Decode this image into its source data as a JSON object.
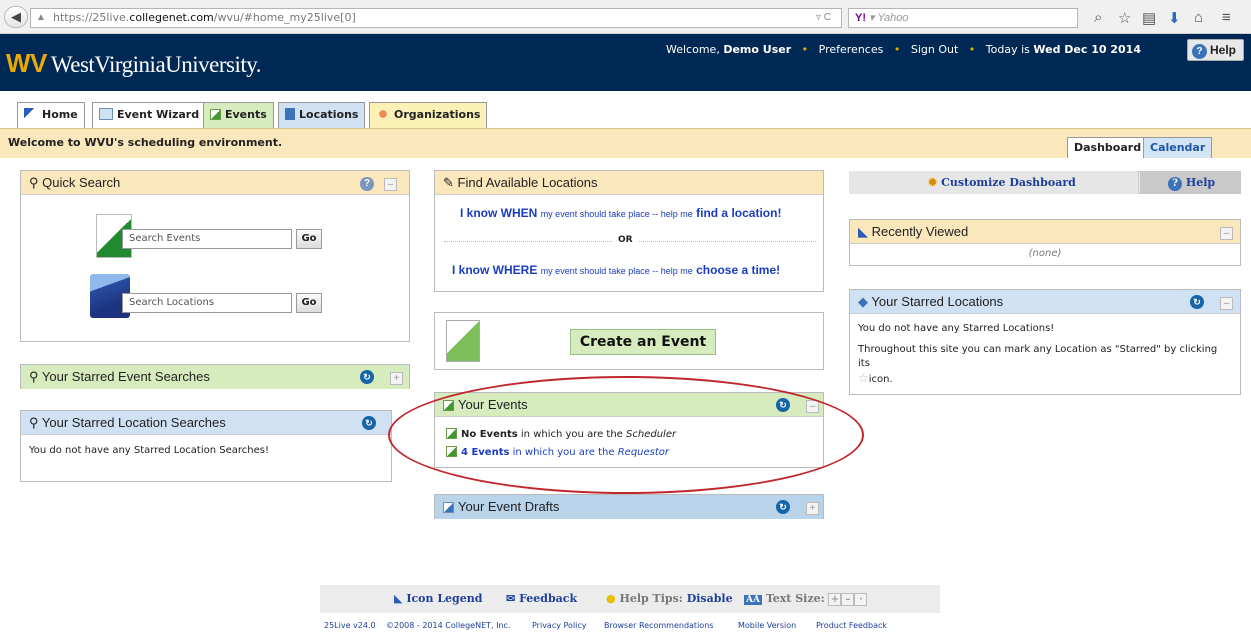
{
  "browser": {
    "url_prefix": "https://25live.",
    "url_domain": "collegenet.com",
    "url_path": "/wvu/#home_my25live[0]",
    "search_engine": "Yahoo",
    "search_placeholder": "Yahoo"
  },
  "header": {
    "logo_mark": "WV",
    "logo_text": "WestVirginiaUniversity.",
    "welcome_prefix": "Welcome,",
    "user_name": "Demo User",
    "preferences": "Preferences",
    "sign_out": "Sign Out",
    "today_prefix": "Today is",
    "today_date": "Wed Dec 10 2014",
    "help": "Help"
  },
  "nav": {
    "tabs": [
      {
        "label": "Home",
        "color": "#ffffff"
      },
      {
        "label": "Event Wizard",
        "color": "#ffffff"
      },
      {
        "label": "Events",
        "color": "#d6ebbe"
      },
      {
        "label": "Locations",
        "color": "#cfe1f3"
      },
      {
        "label": "Organizations",
        "color": "#fbf0b5"
      }
    ],
    "welcome_message": "Welcome to WVU's scheduling environment.",
    "view_tabs": [
      "Dashboard",
      "Calendar"
    ]
  },
  "quick_search": {
    "title": "Quick Search",
    "events_placeholder": "Search Events",
    "locations_placeholder": "Search Locations",
    "go": "Go"
  },
  "starred_event_searches": {
    "title": "Your Starred Event Searches"
  },
  "starred_location_searches": {
    "title": "Your Starred Location Searches",
    "message": "You do not have any Starred Location Searches!"
  },
  "find_locations": {
    "title": "Find Available Locations",
    "when_big": "I know WHEN",
    "when_small": "my event should take place -- help me",
    "when_action": "find a location!",
    "or": "OR",
    "where_big": "I know WHERE",
    "where_small": "my event should take place -- help me",
    "where_action": "choose a time!"
  },
  "create_event": {
    "label": "Create an Event"
  },
  "your_events": {
    "title": "Your Events",
    "scheduler_count": "No Events",
    "scheduler_text": "in which you are the",
    "scheduler_role": "Scheduler",
    "requestor_count": "4 Events",
    "requestor_text": "in which you are the",
    "requestor_role": "Requestor"
  },
  "event_drafts": {
    "title": "Your Event Drafts"
  },
  "right_col": {
    "customize": "Customize Dashboard",
    "help": "Help",
    "recently_viewed_title": "Recently Viewed",
    "recently_viewed_empty": "(none)",
    "starred_locations_title": "Your Starred Locations",
    "starred_locations_msg1": "You do not have any Starred Locations!",
    "starred_locations_msg2": "Throughout this site you can mark any Location as \"Starred\" by clicking its",
    "starred_locations_msg3": "icon."
  },
  "footer": {
    "icon_legend": "Icon Legend",
    "feedback": "Feedback",
    "help_tips_label": "Help Tips:",
    "help_tips_value": "Disable",
    "text_size": "Text Size:",
    "version": "25Live v24.0",
    "copyright": "©2008 - 2014 CollegeNET, Inc.",
    "privacy": "Privacy Policy",
    "browser_rec": "Browser Recommendations",
    "mobile": "Mobile Version",
    "product_feedback": "Product Feedback"
  },
  "colors": {
    "header_navy": "#002855",
    "wvu_gold": "#eaaa00",
    "welcome_bg": "#fbe7bc",
    "events_green": "#d6ebbe",
    "locations_blue": "#cfe1f3",
    "link_blue": "#1a3dbf",
    "annotation_red": "#c0272d"
  }
}
